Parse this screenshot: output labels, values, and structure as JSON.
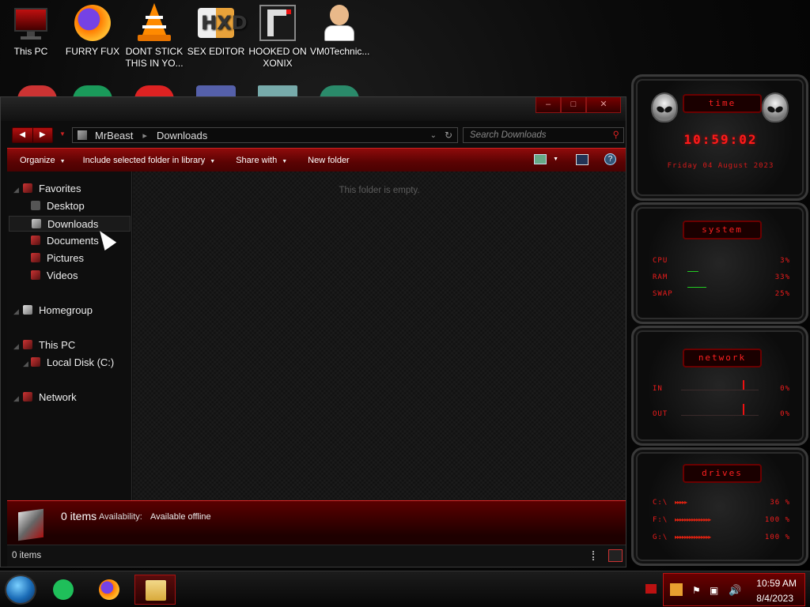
{
  "desktop": {
    "icons": [
      {
        "label": "This PC",
        "icon": "monitor-icon"
      },
      {
        "label": "FURRY FUX",
        "icon": "firefox-icon"
      },
      {
        "label": "DONT STICK THIS IN YO...",
        "icon": "vlc-cone-icon"
      },
      {
        "label": "SEX EDITOR",
        "icon": "hex-editor-icon"
      },
      {
        "label": "HOOKED ON XONIX",
        "icon": "xonix-game-icon"
      },
      {
        "label": "VM0Technic...",
        "icon": "doctor-avatar-icon"
      }
    ]
  },
  "explorer": {
    "address": {
      "root": "MrBeast",
      "current": "Downloads"
    },
    "search_placeholder": "Search Downloads",
    "toolbar": {
      "organize": "Organize",
      "include": "Include selected folder in library",
      "share": "Share with",
      "new_folder": "New folder",
      "help": "?"
    },
    "nav": {
      "favorites": "Favorites",
      "desktop": "Desktop",
      "downloads": "Downloads",
      "documents": "Documents",
      "pictures": "Pictures",
      "videos": "Videos",
      "homegroup": "Homegroup",
      "this_pc": "This PC",
      "local_disk": "Local Disk (C:)",
      "network": "Network"
    },
    "empty_message": "This folder is empty.",
    "details": {
      "count": "0 items",
      "availability_label": "Availability:",
      "availability_value": "Available offline"
    },
    "status": "0 items"
  },
  "gadgets": {
    "time": {
      "title": "time",
      "clock": "10:59:02",
      "date": "Friday 04 August 2023"
    },
    "system": {
      "title": "system",
      "rows": [
        {
          "label": "CPU",
          "value": "3%"
        },
        {
          "label": "RAM",
          "value": "33%"
        },
        {
          "label": "SWAP",
          "value": "25%"
        }
      ]
    },
    "network": {
      "title": "network",
      "rows": [
        {
          "label": "IN",
          "value": "0%"
        },
        {
          "label": "OUT",
          "value": "0%"
        }
      ]
    },
    "drives": {
      "title": "drives",
      "rows": [
        {
          "label": "C:\\",
          "value": "36 %"
        },
        {
          "label": "F:\\",
          "value": "100 %"
        },
        {
          "label": "G:\\",
          "value": "100 %"
        }
      ]
    }
  },
  "taskbar": {
    "time": "10:59 AM",
    "date": "8/4/2023"
  },
  "colors": {
    "accent": "#c00000",
    "gadget_text": "#ff1a1a",
    "background": "#000000"
  }
}
